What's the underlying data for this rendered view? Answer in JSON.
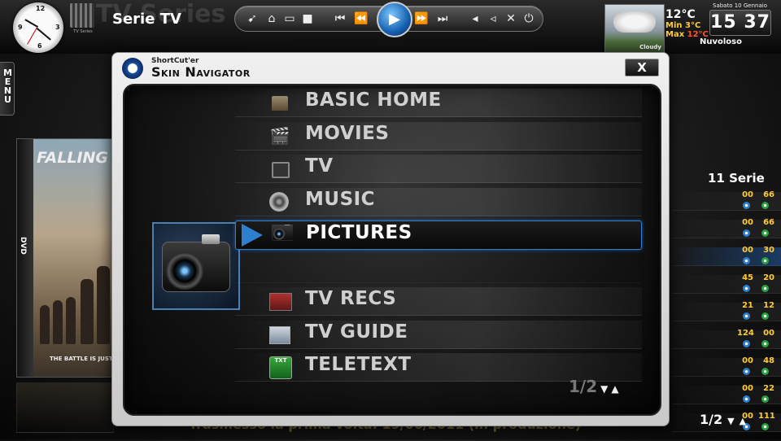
{
  "header": {
    "section_title": "Serie TV",
    "ghost_title": "TV Series",
    "logo_caption": "TV Series"
  },
  "transport": {
    "buttons": [
      "skip-back-icon",
      "home-icon",
      "window-icon",
      "stop-icon",
      "previous-icon",
      "rewind-icon",
      "play-icon",
      "forward-icon",
      "next-icon",
      "volume-down-icon",
      "volume-up-icon",
      "mute-icon",
      "power-icon"
    ]
  },
  "weather": {
    "image_label": "Cloudy",
    "temperature": "12°C",
    "min_label": "Min",
    "min_value": "3°C",
    "max_label": "Max",
    "max_value": "12°C",
    "condition": "Nuvoloso"
  },
  "datetime": {
    "date": "Sabato 10 Gennaio",
    "time_hours": "15",
    "time_minutes": "37"
  },
  "side_menu": {
    "label": "MENU"
  },
  "background": {
    "poster_title": "FALLING",
    "poster_tagline": "THE BATTLE IS JUST",
    "poster_badge": "DVD",
    "series_count": "11 Serie",
    "info_text": "Trasmesso la prima volta: 19/06/2011 (in produzione)",
    "pager": "1/2",
    "rows": [
      {
        "a": "00",
        "b": "66"
      },
      {
        "a": "00",
        "b": "66"
      },
      {
        "a": "00",
        "b": "30"
      },
      {
        "a": "45",
        "b": "20"
      },
      {
        "a": "21",
        "b": "12"
      },
      {
        "a": "124",
        "b": "00"
      },
      {
        "a": "00",
        "b": "48"
      },
      {
        "a": "00",
        "b": "22"
      },
      {
        "a": "00",
        "b": "111"
      }
    ]
  },
  "dialog": {
    "subtitle": "ShortCut'er",
    "title": "Skin Navigator",
    "close_label": "X",
    "pager": "1/2",
    "selected_index": 4,
    "items": [
      {
        "label": "BASIC HOME",
        "icon": "house-icon"
      },
      {
        "label": "MOVIES",
        "icon": "clapperboard-icon"
      },
      {
        "label": "TV",
        "icon": "tv-icon"
      },
      {
        "label": "MUSIC",
        "icon": "speaker-icon"
      },
      {
        "label": "PICTURES",
        "icon": "camera-icon"
      },
      {
        "label": "",
        "icon": ""
      },
      {
        "label": "TV RECS",
        "icon": "tv-recordings-icon"
      },
      {
        "label": "TV GUIDE",
        "icon": "tv-guide-icon"
      },
      {
        "label": "TELETEXT",
        "icon": "teletext-icon",
        "icon_text": "TXT"
      }
    ]
  }
}
